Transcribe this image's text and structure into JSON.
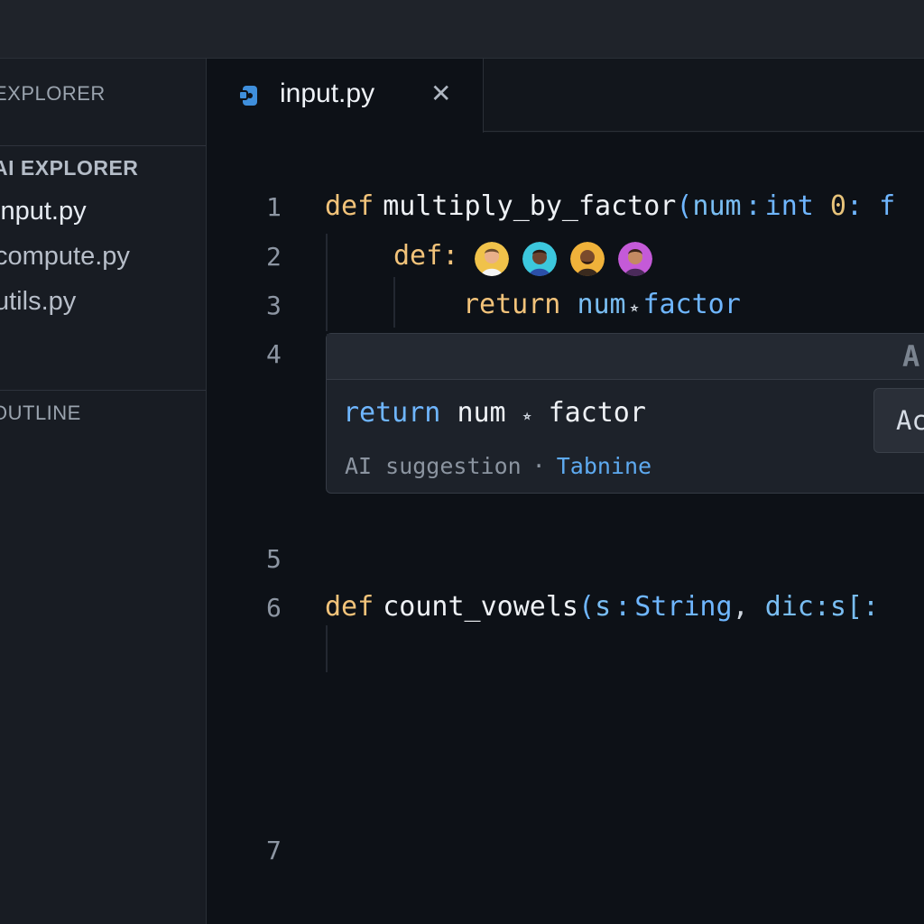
{
  "sidebar": {
    "title": "EXPLORER",
    "section": "AI EXPLORER",
    "files": [
      "input.py",
      "compute.py",
      "utils.py"
    ],
    "outline": "OUTLINE"
  },
  "tab": {
    "label": "input.py",
    "close": "✕",
    "icon": "python-file-icon"
  },
  "editor": {
    "line_numbers": [
      "1",
      "2",
      "3",
      "4",
      "5",
      "6",
      "7"
    ],
    "line1": {
      "kw": "def",
      "name": "multiply_by_factor",
      "paren": "(",
      "param": "num",
      "colon": ":",
      "type": "int",
      "zero": "0",
      "colon2": ":",
      "cut": "f"
    },
    "line2": {
      "kw": "def",
      "colon": ":"
    },
    "line3": {
      "kw": "return",
      "a": "num",
      "op": "⭒",
      "b": "factor"
    },
    "line6": {
      "kw": "def",
      "name": "count_vowels",
      "paren": "(",
      "param": "s",
      "colon": ":",
      "type": "String",
      "comma": ",",
      "rest": "dic:s[:"
    }
  },
  "avatars": [
    {
      "name": "avatar-1",
      "bg": "#f0c24a",
      "skin": "#e9b08a",
      "hair": "#6b4c2e"
    },
    {
      "name": "avatar-2",
      "bg": "#3cc7dd",
      "skin": "#6b4330",
      "hair": "#2a1a12"
    },
    {
      "name": "avatar-3",
      "bg": "#f0b23a",
      "skin": "#7a4a2c",
      "hair": "#2b1a10"
    },
    {
      "name": "avatar-4",
      "bg": "#c45ad8",
      "skin": "#c48a62",
      "hair": "#3b2418"
    }
  ],
  "suggestion": {
    "header": "A",
    "code": {
      "kw": "return",
      "a": "num",
      "op": "⭒",
      "b": "factor"
    },
    "label": "AI suggestion",
    "dot": "·",
    "brand": "Tabnine",
    "accept": "Accept"
  },
  "colors": {
    "keyword": "#f2c37a",
    "type": "#6fb6ff",
    "brand": "#5eaaf0",
    "background": "#0d1117"
  }
}
